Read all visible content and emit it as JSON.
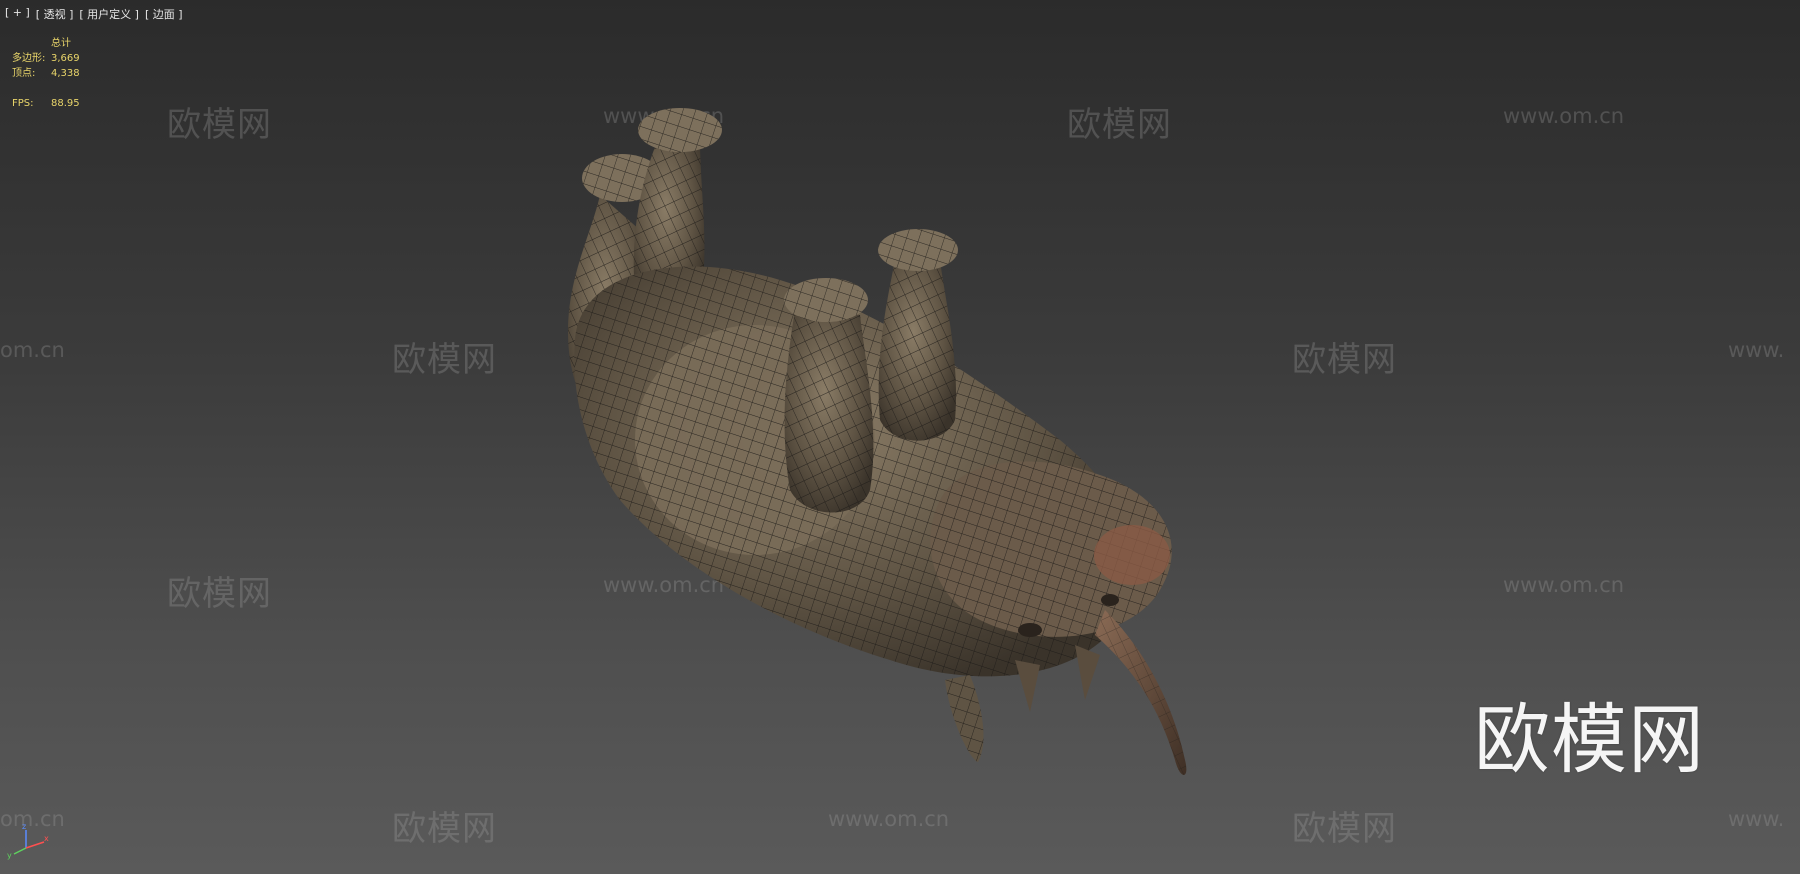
{
  "viewport": {
    "labels": [
      "[ + ]",
      "[ 透视 ]",
      "[ 用户定义 ]",
      "[ 边面 ]"
    ]
  },
  "stats": {
    "total_label": "总计",
    "polygons_label": "多边形:",
    "polygons_value": "3,669",
    "vertices_label": "顶点:",
    "vertices_value": "4,338",
    "fps_label": "FPS:",
    "fps_value": "88.95"
  },
  "watermarks": {
    "cn_text": "欧模网",
    "url_text": "www.om.cn",
    "url_partial_left": "om.cn",
    "url_partial_right": "www."
  },
  "big_watermark": "欧模网",
  "gizmo": {
    "axis_x": "x",
    "axis_y": "y",
    "axis_z": "z"
  },
  "colors": {
    "stats_text": "#e9d56a",
    "model_skin": "#6e6250",
    "wire": "#1c1a17"
  }
}
